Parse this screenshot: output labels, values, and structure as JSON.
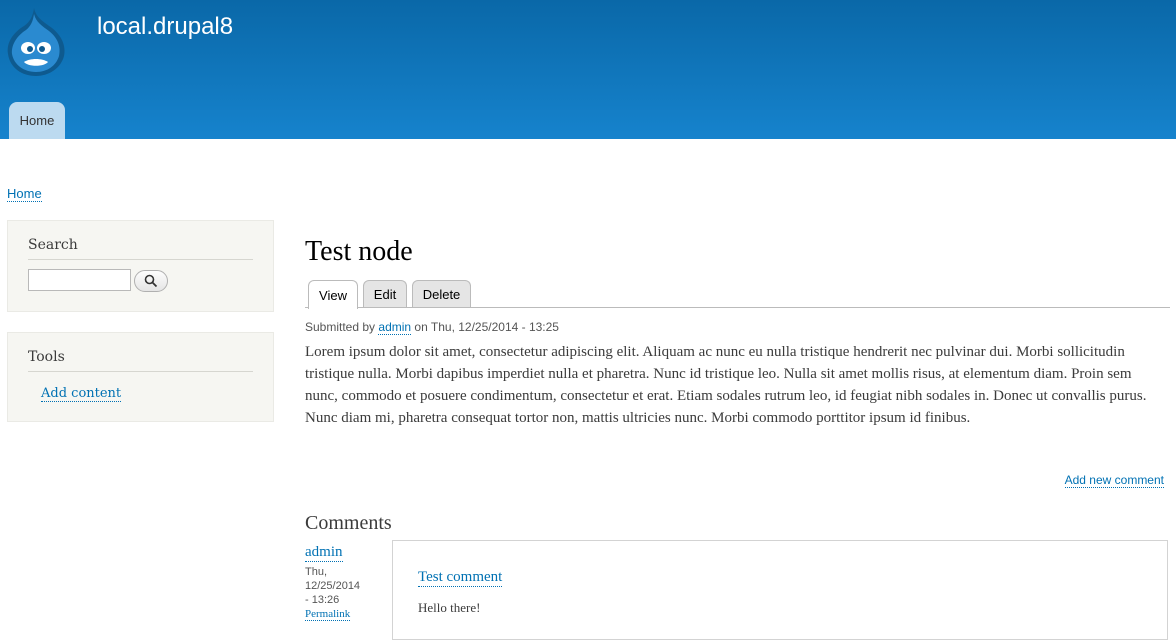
{
  "header": {
    "site_name": "local.drupal8",
    "nav": [
      {
        "label": "Home"
      }
    ]
  },
  "breadcrumb": {
    "home": "Home"
  },
  "sidebar": {
    "search": {
      "title": "Search",
      "placeholder": "",
      "button_icon": "search-icon"
    },
    "tools": {
      "title": "Tools",
      "links": [
        {
          "label": "Add content"
        }
      ]
    }
  },
  "node": {
    "title": "Test node",
    "tabs": [
      {
        "label": "View",
        "active": true
      },
      {
        "label": "Edit"
      },
      {
        "label": "Delete"
      }
    ],
    "submitted_prefix": "Submitted by",
    "author": "admin",
    "date_text": "on Thu, 12/25/2014 - 13:25",
    "body": "Lorem ipsum dolor sit amet, consectetur adipiscing elit. Aliquam ac nunc eu nulla tristique hendrerit nec pulvinar dui. Morbi sollicitudin tristique nulla. Morbi dapibus imperdiet nulla et pharetra. Nunc id tristique leo. Nulla sit amet mollis risus, at elementum diam. Proin sem nunc, commodo et posuere condimentum, consectetur et erat. Etiam sodales rutrum leo, id feugiat nibh sodales in. Donec ut convallis purus. Nunc diam mi, pharetra consequat tortor non, mattis ultricies nunc. Morbi commodo porttitor ipsum id finibus.",
    "add_comment": "Add new comment"
  },
  "comments": {
    "title": "Comments",
    "items": [
      {
        "author": "admin",
        "date_lines": [
          "Thu,",
          "12/25/2014",
          "- 13:26"
        ],
        "permalink": "Permalink",
        "subject": "Test comment",
        "body": "Hello there!"
      }
    ]
  },
  "colors": {
    "header_top": "#0a68a8",
    "header_bottom": "#1683cd",
    "link": "#0071b3",
    "sidebar_bg": "#f6f6f2"
  }
}
